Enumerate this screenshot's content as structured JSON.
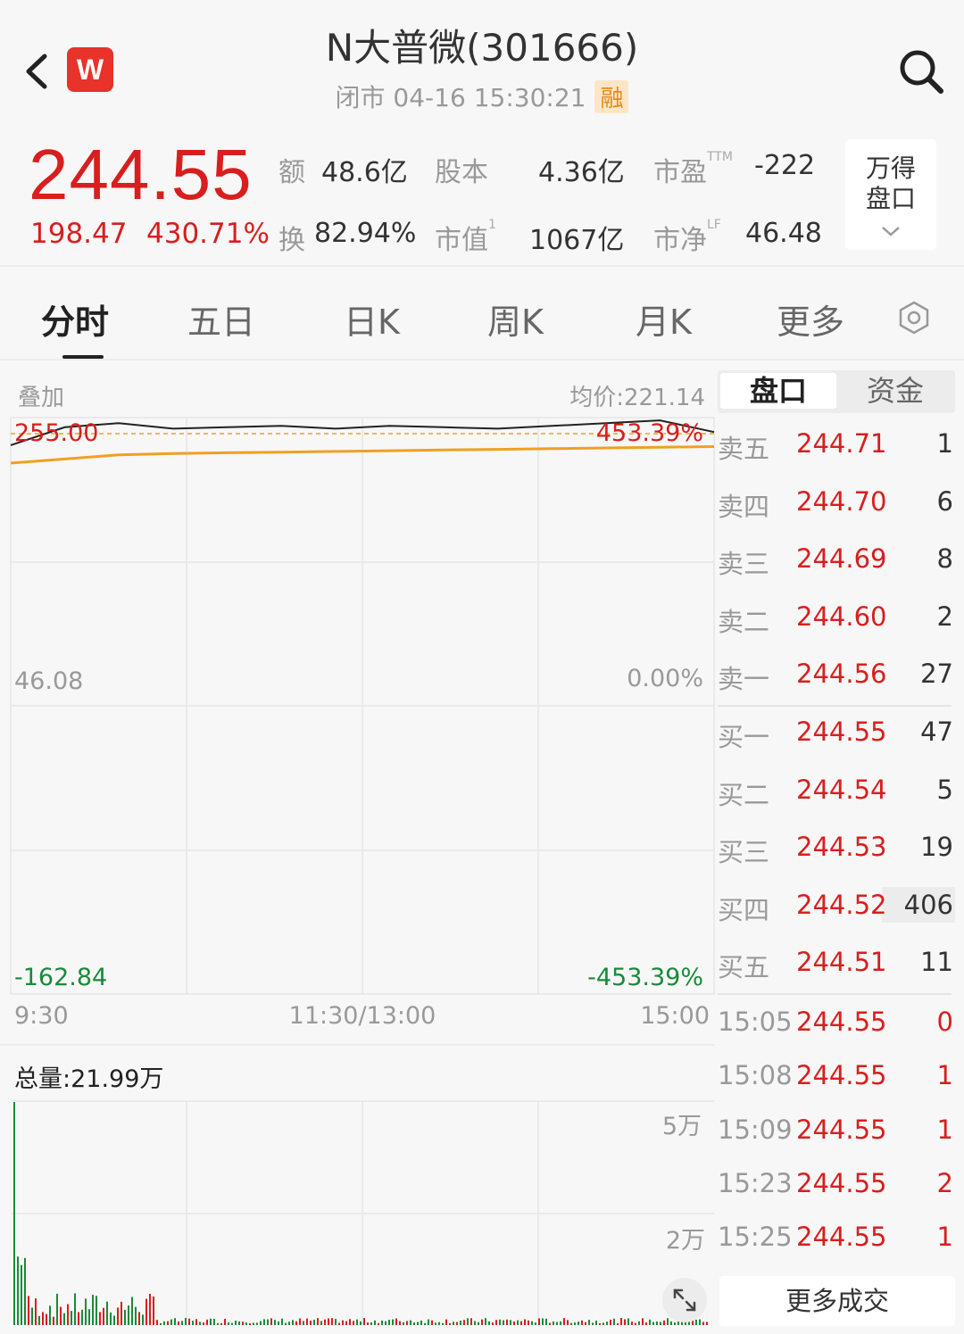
{
  "header": {
    "title": "N大普微(301666)",
    "status": "闭市 04-16 15:30:21",
    "badge": "融",
    "logo_text": "W"
  },
  "quote": {
    "price": "244.55",
    "change": "198.47",
    "change_pct": "430.71%",
    "amount_label": "额",
    "amount": "48.6亿",
    "share_cap_label": "股本",
    "share_cap": "4.36亿",
    "pe_label": "市盈",
    "pe_sup": "TTM",
    "pe": "-222",
    "turnover_label": "换",
    "turnover": "82.94%",
    "mkt_cap_label": "市值",
    "mkt_cap_sup": "1",
    "mkt_cap": "1067亿",
    "pb_label": "市净",
    "pb_sup": "LF",
    "pb": "46.48",
    "wind_btn_line1": "万得",
    "wind_btn_line2": "盘口"
  },
  "tabs": [
    "分时",
    "五日",
    "日K",
    "周K",
    "月K",
    "更多"
  ],
  "chart": {
    "overlay_label": "叠加",
    "avg_price": "均价:221.14",
    "y_max": "255.00",
    "y_max_pct": "453.39%",
    "y_mid": "46.08",
    "y_mid_pct": "0.00%",
    "y_min": "-162.84",
    "y_min_pct": "-453.39%",
    "x_labels": [
      "9:30",
      "11:30/13:00",
      "15:00"
    ],
    "volume_total": "总量:21.99万",
    "vol_labels": [
      "5万",
      "2万"
    ],
    "colors": {
      "price_line": "#222222",
      "avg_line": "#f0a020",
      "up": "#d81e1e",
      "down": "#1a8a3a"
    }
  },
  "chart_data": {
    "type": "line",
    "x": [
      "9:30",
      "11:30/13:00",
      "15:00"
    ],
    "series": [
      {
        "values": [
          235,
          248,
          251,
          247,
          248,
          249,
          247,
          249,
          248,
          247,
          249,
          251,
          253,
          244.55
        ]
      },
      {
        "values": [
          222,
          225,
          228,
          229,
          229.5,
          230,
          230.5,
          231,
          231.5,
          232,
          232.5,
          233,
          233.5,
          234
        ]
      }
    ],
    "ylim": [
      -162.84,
      255.0
    ],
    "grid": true
  },
  "orderbook": {
    "tab_active": "盘口",
    "tab_inactive": "资金",
    "asks": [
      {
        "label": "卖五",
        "price": "244.71",
        "vol": "1"
      },
      {
        "label": "卖四",
        "price": "244.70",
        "vol": "6"
      },
      {
        "label": "卖三",
        "price": "244.69",
        "vol": "8"
      },
      {
        "label": "卖二",
        "price": "244.60",
        "vol": "2"
      },
      {
        "label": "卖一",
        "price": "244.56",
        "vol": "27"
      }
    ],
    "bids": [
      {
        "label": "买一",
        "price": "244.55",
        "vol": "47"
      },
      {
        "label": "买二",
        "price": "244.54",
        "vol": "5"
      },
      {
        "label": "买三",
        "price": "244.53",
        "vol": "19"
      },
      {
        "label": "买四",
        "price": "244.52",
        "vol": "406"
      },
      {
        "label": "买五",
        "price": "244.51",
        "vol": "11"
      }
    ],
    "ticks": [
      {
        "time": "15:05",
        "price": "244.55",
        "vol": "0"
      },
      {
        "time": "15:08",
        "price": "244.55",
        "vol": "1"
      },
      {
        "time": "15:09",
        "price": "244.55",
        "vol": "1"
      },
      {
        "time": "15:23",
        "price": "244.55",
        "vol": "2"
      },
      {
        "time": "15:25",
        "price": "244.55",
        "vol": "1"
      }
    ],
    "more_button": "更多成交"
  }
}
